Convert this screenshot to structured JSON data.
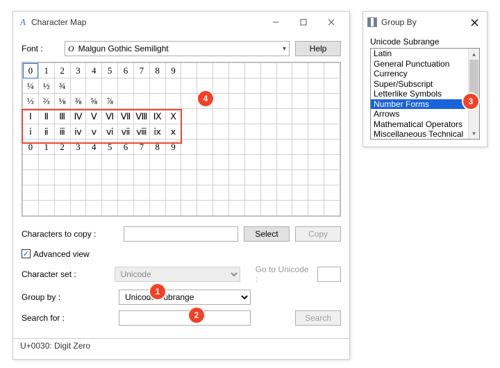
{
  "charmap": {
    "title": "Character Map",
    "font_label": "Font :",
    "font_value": "Malgun Gothic Semilight",
    "help_label": "Help",
    "grid": {
      "cols": 20,
      "rows": [
        [
          "0",
          "1",
          "2",
          "3",
          "4",
          "5",
          "6",
          "7",
          "8",
          "9",
          "",
          "",
          "",
          "",
          "",
          "",
          "",
          "",
          "",
          ""
        ],
        [
          "¼",
          "½",
          "¾",
          "",
          "",
          "",
          "",
          "",
          "",
          "",
          "",
          "",
          "",
          "",
          "",
          "",
          "",
          "",
          "",
          ""
        ],
        [
          "⅓",
          "⅔",
          "⅛",
          "⅜",
          "⅝",
          "⅞",
          "",
          "",
          "",
          "",
          "",
          "",
          "",
          "",
          "",
          "",
          "",
          "",
          "",
          ""
        ],
        [
          "Ⅰ",
          "Ⅱ",
          "Ⅲ",
          "Ⅳ",
          "Ⅴ",
          "Ⅵ",
          "Ⅶ",
          "Ⅷ",
          "Ⅸ",
          "Ⅹ",
          "",
          "",
          "",
          "",
          "",
          "",
          "",
          "",
          "",
          ""
        ],
        [
          "ⅰ",
          "ⅱ",
          "ⅲ",
          "ⅳ",
          "ⅴ",
          "ⅵ",
          "ⅶ",
          "ⅷ",
          "ⅸ",
          "ⅹ",
          "",
          "",
          "",
          "",
          "",
          "",
          "",
          "",
          "",
          ""
        ],
        [
          "0",
          "1",
          "2",
          "3",
          "4",
          "5",
          "6",
          "7",
          "8",
          "9",
          "",
          "",
          "",
          "",
          "",
          "",
          "",
          "",
          "",
          ""
        ],
        [
          "",
          "",
          "",
          "",
          "",
          "",
          "",
          "",
          "",
          "",
          "",
          "",
          "",
          "",
          "",
          "",
          "",
          "",
          "",
          ""
        ],
        [
          "",
          "",
          "",
          "",
          "",
          "",
          "",
          "",
          "",
          "",
          "",
          "",
          "",
          "",
          "",
          "",
          "",
          "",
          "",
          ""
        ],
        [
          "",
          "",
          "",
          "",
          "",
          "",
          "",
          "",
          "",
          "",
          "",
          "",
          "",
          "",
          "",
          "",
          "",
          "",
          "",
          ""
        ],
        [
          "",
          "",
          "",
          "",
          "",
          "",
          "",
          "",
          "",
          "",
          "",
          "",
          "",
          "",
          "",
          "",
          "",
          "",
          "",
          ""
        ]
      ],
      "selected": {
        "row": 0,
        "col": 0
      }
    },
    "chars_to_copy_label": "Characters to copy :",
    "chars_to_copy_value": "",
    "select_label": "Select",
    "copy_label": "Copy",
    "advanced_view_label": "Advanced view",
    "advanced_view_checked": true,
    "charset_label": "Character set :",
    "charset_value": "Unicode",
    "goto_label": "Go to Unicode :",
    "goto_value": "",
    "groupby_label": "Group by :",
    "groupby_value": "Unicode Subrange",
    "search_label": "Search for :",
    "search_value": "",
    "search_button": "Search",
    "statusbar": "U+0030: Digit Zero"
  },
  "groupby_window": {
    "title": "Group By",
    "label": "Unicode Subrange",
    "items": [
      "Latin",
      "General Punctuation",
      "Currency",
      "Super/Subscript",
      "Letterlike Symbols",
      "Number Forms",
      "Arrows",
      "Mathematical Operators",
      "Miscellaneous Technical"
    ],
    "selected_index": 5
  },
  "callouts": {
    "c1": "1",
    "c2": "2",
    "c3": "3",
    "c4": "4"
  }
}
